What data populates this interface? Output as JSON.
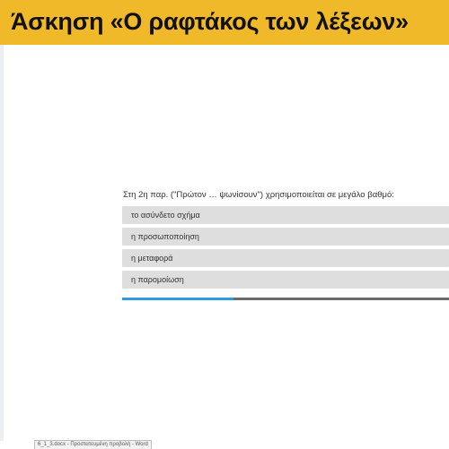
{
  "header": {
    "title": "Άσκηση «Ο ραφτάκος των λέξεων»"
  },
  "quiz": {
    "question": "Στη 2η παρ. (\"Πρώτον … ψωνίσουν\") χρησιμοποιείται σε μεγάλο βαθμό:",
    "options": [
      "το ασύνδετο σχήμα",
      "η προσωποποίηση",
      "η μεταφορά",
      "η παρομοίωση"
    ],
    "progress_fraction": 0.34
  },
  "taskbar": {
    "window_label": "6_1_3.docx - Προστατευμένη προβολή - Word"
  },
  "colors": {
    "banner": "#f0b92a",
    "option_bg": "#dedede",
    "progress_fill": "#2e9be0",
    "progress_track": "#6b6b6b"
  }
}
